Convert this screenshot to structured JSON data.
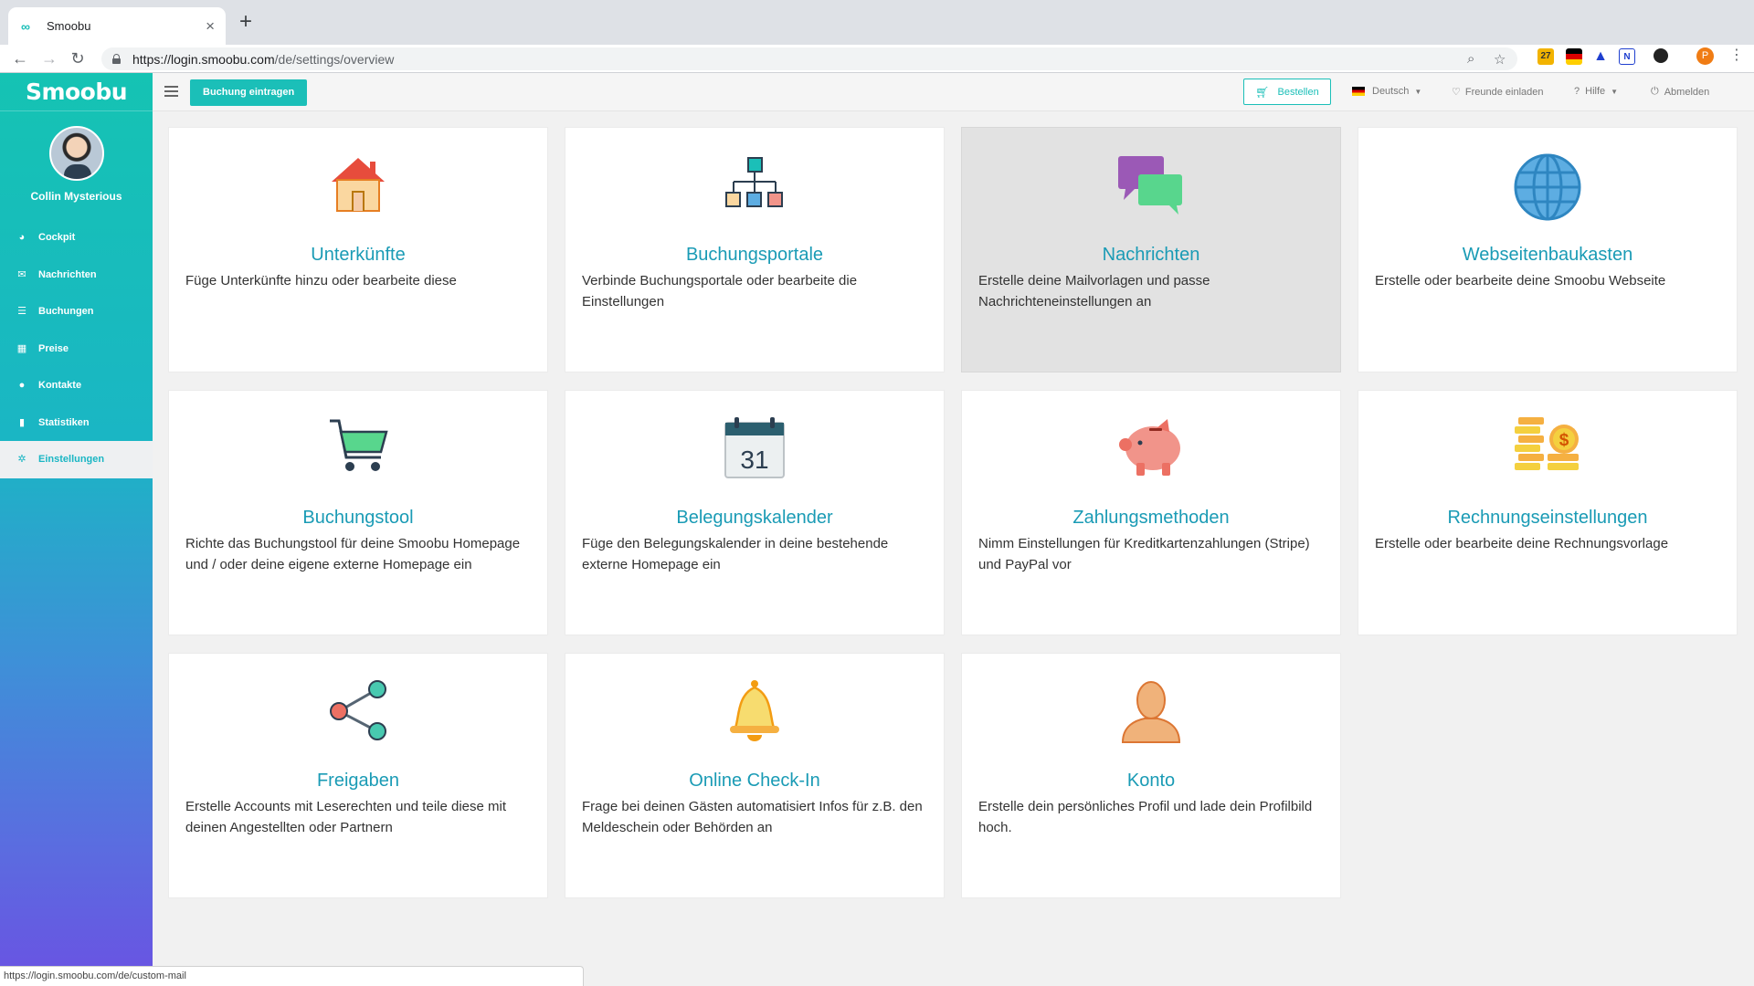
{
  "browser": {
    "tab_title": "Smoobu",
    "url_main": "https://login.smoobu.com",
    "url_rest": "/de/settings/overview",
    "extension_badge": "27",
    "profile_initial": "P"
  },
  "sidebar": {
    "brand": "Smoobu",
    "user_name": "Collin Mysterious",
    "items": [
      {
        "label": "Cockpit",
        "icon": "dashboard-icon"
      },
      {
        "label": "Nachrichten",
        "icon": "envelope-icon"
      },
      {
        "label": "Buchungen",
        "icon": "list-icon"
      },
      {
        "label": "Preise",
        "icon": "calculator-icon"
      },
      {
        "label": "Kontakte",
        "icon": "users-icon"
      },
      {
        "label": "Statistiken",
        "icon": "bar-chart-icon"
      },
      {
        "label": "Einstellungen",
        "icon": "gear-icon",
        "active": true
      }
    ]
  },
  "topbar": {
    "add_booking": "Buchung eintragen",
    "order": "Bestellen",
    "language": "Deutsch",
    "invite": "Freunde einladen",
    "help": "Hilfe",
    "logout": "Abmelden"
  },
  "cards": [
    {
      "title": "Unterkünfte",
      "desc": "Füge Unterkünfte hinzu oder bearbeite diese",
      "icon": "house-icon"
    },
    {
      "title": "Buchungsportale",
      "desc": "Verbinde Buchungsportale oder bearbeite die Einstellungen",
      "icon": "sitemap-icon"
    },
    {
      "title": "Nachrichten",
      "desc": "Erstelle deine Mailvorlagen und passe Nachrichteneinstellungen an",
      "icon": "chat-bubbles-icon",
      "highlighted": true
    },
    {
      "title": "Webseitenbaukasten",
      "desc": "Erstelle oder bearbeite deine Smoobu Webseite",
      "icon": "globe-icon"
    },
    {
      "title": "Buchungstool",
      "desc": "Richte das Buchungstool für deine Smoobu Homepage und / oder deine eigene externe Homepage ein",
      "icon": "shopping-cart-icon"
    },
    {
      "title": "Belegungskalender",
      "desc": "Füge den Belegungskalender in deine bestehende externe Homepage ein",
      "icon": "calendar-icon",
      "icon_text": "31"
    },
    {
      "title": "Zahlungsmethoden",
      "desc": "Nimm Einstellungen für Kreditkartenzahlungen (Stripe) und PayPal vor",
      "icon": "piggy-bank-icon"
    },
    {
      "title": "Rechnungseinstellungen",
      "desc": "Erstelle oder bearbeite deine Rechnungsvorlage",
      "icon": "coins-icon",
      "icon_text": "$"
    },
    {
      "title": "Freigaben",
      "desc": "Erstelle Accounts mit Leserechten und teile diese mit deinen Angestellten oder Partnern",
      "icon": "share-icon"
    },
    {
      "title": "Online Check-In",
      "desc": "Frage bei deinen Gästen automatisiert Infos für z.B. den Meldeschein oder Behörden an",
      "icon": "bell-icon"
    },
    {
      "title": "Konto",
      "desc": "Erstelle dein persönliches Profil und lade dein Profilbild hoch.",
      "icon": "user-silhouette-icon"
    }
  ],
  "status_url": "https://login.smoobu.com/de/custom-mail",
  "colors": {
    "accent": "#1bbfb8",
    "title": "#1a9bb5"
  }
}
